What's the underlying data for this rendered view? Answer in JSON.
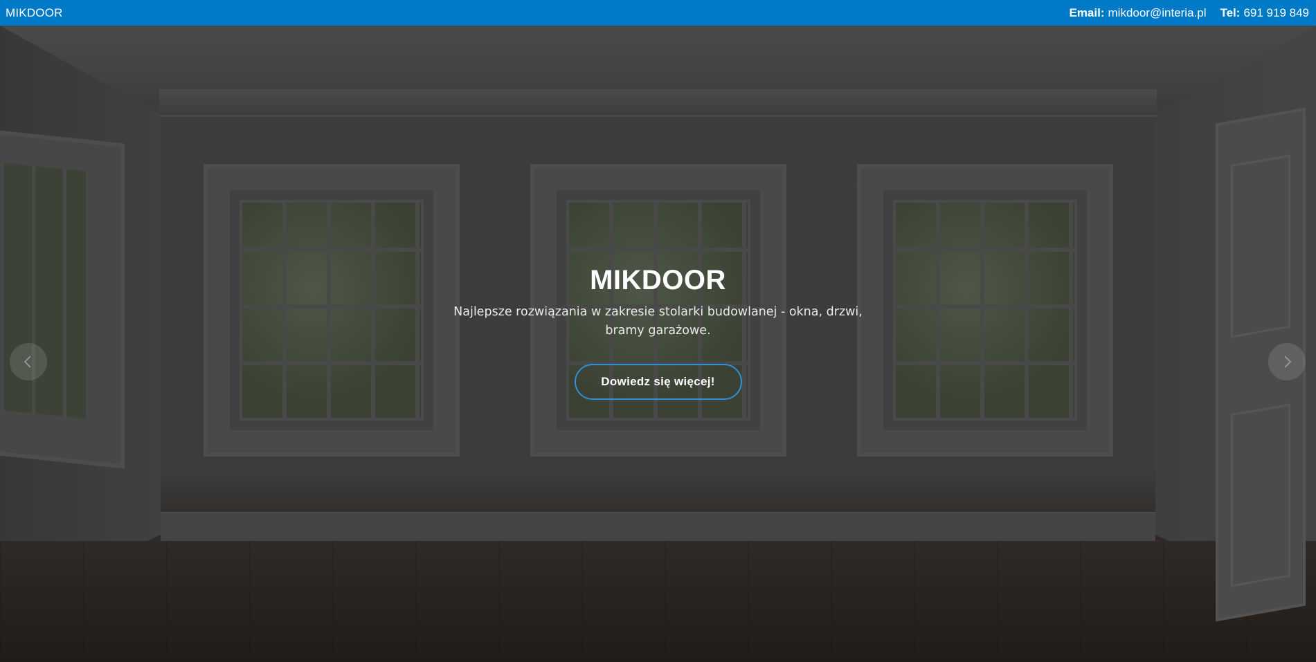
{
  "topbar": {
    "brand": "MIKDOOR",
    "email_label": "Email:",
    "email_value": "mikdoor@interia.pl",
    "phone_label": "Tel:",
    "phone_value": "691 919 849",
    "background_color": "#0079c6"
  },
  "hero": {
    "title": "MIKDOOR",
    "subtitle": "Najlepsze rozwiązania w zakresie stolarki budowlanej - okna, drzwi, bramy garażowe.",
    "cta_label": "Dowiedz się więcej!",
    "cta_border_color": "#2f91d8",
    "prev_icon": "chevron-left-icon",
    "next_icon": "chevron-right-icon"
  }
}
